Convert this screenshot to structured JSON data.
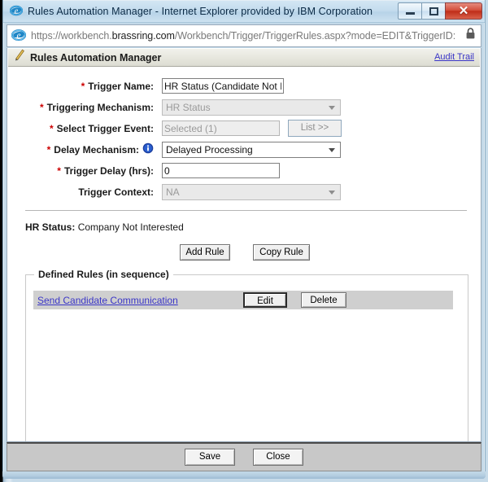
{
  "window": {
    "title": "Rules Automation Manager - Internet Explorer provided by IBM Corporation",
    "app_icon": "ie-logo-icon",
    "minimize_label": "–",
    "maximize_label": "□",
    "close_label": "✕"
  },
  "address_bar": {
    "icon": "ie-logo-icon",
    "url_prefix": "https://workbench.",
    "url_domain": "brassring.com",
    "url_path": "/Workbench/Trigger/TriggerRules.aspx?mode=EDIT&TriggerID:",
    "lock_icon": "lock-icon"
  },
  "page": {
    "header": {
      "icon": "pencil-icon",
      "title": "Rules Automation Manager",
      "audit_trail_label": "Audit Trail"
    },
    "form": {
      "required_marker": "*",
      "fields": [
        {
          "label": "Trigger Name:",
          "required": true,
          "type": "text",
          "value": "HR Status (Candidate Not Int",
          "disabled": false
        },
        {
          "label": "Triggering Mechanism:",
          "required": true,
          "type": "select",
          "value": "HR Status",
          "disabled": true
        },
        {
          "label": "Select Trigger Event:",
          "required": true,
          "type": "text-with-button",
          "value": "Selected (1)",
          "disabled": true,
          "button_label": "List >>"
        },
        {
          "label": "Delay Mechanism:",
          "required": true,
          "type": "select",
          "value": "Delayed Processing",
          "disabled": false,
          "info_icon": "info-icon"
        },
        {
          "label": "Trigger Delay (hrs):",
          "required": true,
          "type": "text",
          "value": "0",
          "disabled": false
        },
        {
          "label": "Trigger Context:",
          "required": false,
          "type": "select",
          "value": "NA",
          "disabled": true
        }
      ]
    },
    "hr_status": {
      "key": "HR Status:",
      "value": "Company Not Interested"
    },
    "rule_actions": {
      "add_rule_label": "Add Rule",
      "copy_rule_label": "Copy Rule"
    },
    "defined_rules": {
      "legend": "Defined Rules (in sequence)",
      "rows": [
        {
          "name": "Send Candidate Communication",
          "edit_label": "Edit",
          "delete_label": "Delete"
        }
      ]
    },
    "footer": {
      "save_label": "Save",
      "close_label": "Close"
    }
  },
  "colors": {
    "required_red": "#cc0000",
    "link_blue": "#3a35c7",
    "row_gray": "#cfcfcf",
    "chrome_blue": "#c3d9e8",
    "close_red": "#bf2d18"
  }
}
